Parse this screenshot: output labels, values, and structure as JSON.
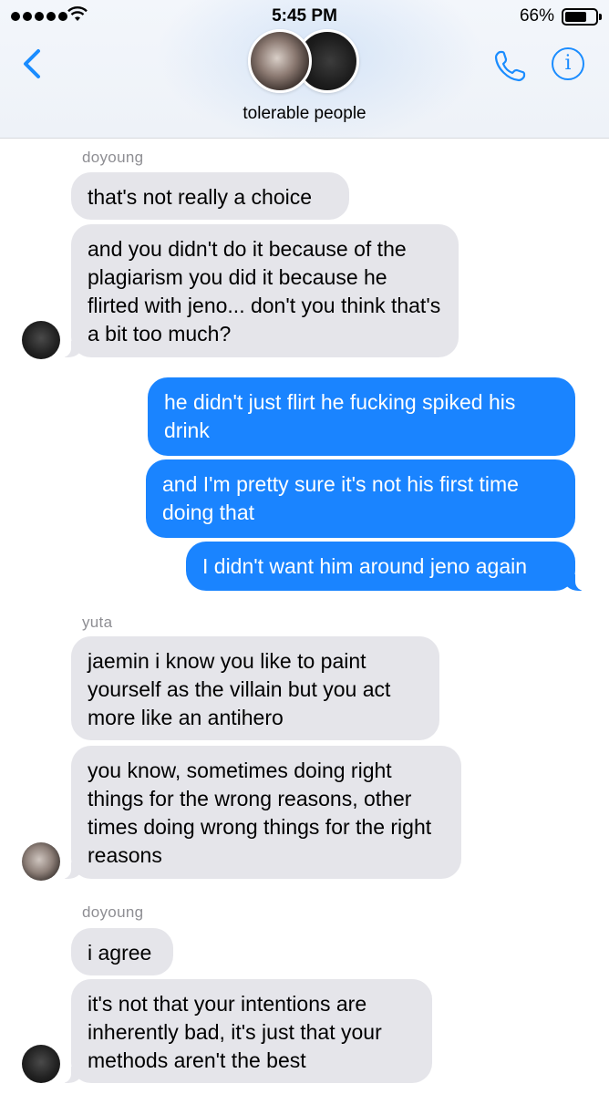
{
  "status_bar": {
    "time": "5:45 PM",
    "battery": "66%",
    "battery_level": 0.66
  },
  "header": {
    "title": "tolerable people",
    "icons": [
      "chevron-left-icon",
      "phone-icon",
      "info-icon"
    ],
    "info_glyph": "i"
  },
  "colors": {
    "accent": "#1a8cff",
    "outgoing": "#1a84ff",
    "incoming": "#e5e5ea",
    "sender": "#8e8e93"
  },
  "messages": {
    "doyoung_label_1": "doyoung",
    "m1": "that's not really a choice",
    "m2": "and you didn't do it because of the plagiarism you did it because he flirted with jeno... don't you think that's a bit too much?",
    "m3": "he didn't just flirt he fucking spiked his drink",
    "m4": "and I'm pretty sure it's not his first time doing that",
    "m5": "I didn't want him around jeno again",
    "yuta_label": "yuta",
    "m6": "jaemin i know you like to paint yourself as the villain but you act more like an antihero",
    "m7": "you know, sometimes doing right things for the wrong reasons, other times doing wrong things for the right reasons",
    "doyoung_label_2": "doyoung",
    "m8": "i agree",
    "m9": "it's not that your intentions are inherently bad, it's just that your methods aren't the best"
  }
}
